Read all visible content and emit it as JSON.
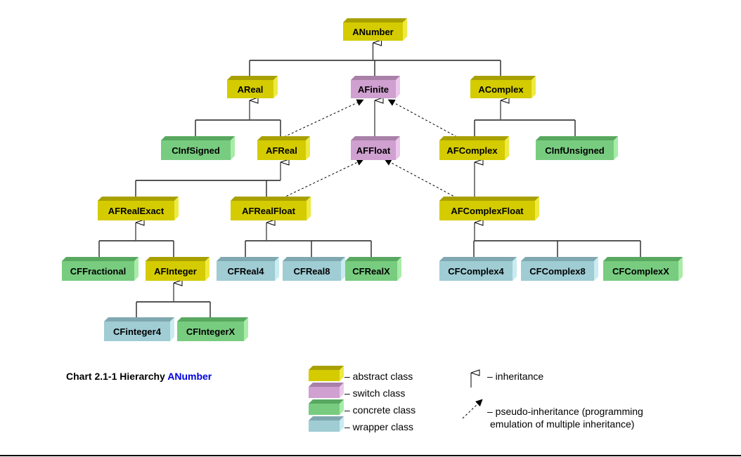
{
  "caption": {
    "prefix": "Chart 2.1-1 Hierarchy ",
    "accent": "ANumber",
    "accent_color": "#0000dd"
  },
  "class_types": {
    "abstract": {
      "front": "#d4cc00",
      "top": "#a8a000",
      "side": "#eeea40"
    },
    "switch": {
      "front": "#cfa0d0",
      "top": "#a880a8",
      "side": "#ecc8ec"
    },
    "concrete": {
      "front": "#78cc80",
      "top": "#58a860",
      "side": "#a8eca8"
    },
    "wrapper": {
      "front": "#a0ccd4",
      "top": "#80a8b0",
      "side": "#c8ecf0"
    }
  },
  "nodes": [
    {
      "id": "ANumber",
      "label": "ANumber",
      "type": "abstract"
    },
    {
      "id": "AReal",
      "label": "AReal",
      "type": "abstract"
    },
    {
      "id": "AFinite",
      "label": "AFinite",
      "type": "switch"
    },
    {
      "id": "AComplex",
      "label": "AComplex",
      "type": "abstract"
    },
    {
      "id": "CInfSigned",
      "label": "CInfSigned",
      "type": "concrete"
    },
    {
      "id": "AFReal",
      "label": "AFReal",
      "type": "abstract"
    },
    {
      "id": "AFFloat",
      "label": "AFFloat",
      "type": "switch"
    },
    {
      "id": "AFComplex",
      "label": "AFComplex",
      "type": "abstract"
    },
    {
      "id": "CInfUnsigned",
      "label": "CInfUnsigned",
      "type": "concrete"
    },
    {
      "id": "AFRealExact",
      "label": "AFRealExact",
      "type": "abstract"
    },
    {
      "id": "AFRealFloat",
      "label": "AFRealFloat",
      "type": "abstract"
    },
    {
      "id": "AFComplexFloat",
      "label": "AFComplexFloat",
      "type": "abstract"
    },
    {
      "id": "CFFractional",
      "label": "CFFractional",
      "type": "concrete"
    },
    {
      "id": "AFInteger",
      "label": "AFInteger",
      "type": "abstract"
    },
    {
      "id": "CFReal4",
      "label": "CFReal4",
      "type": "wrapper"
    },
    {
      "id": "CFReal8",
      "label": "CFReal8",
      "type": "wrapper"
    },
    {
      "id": "CFRealX",
      "label": "CFRealX",
      "type": "concrete"
    },
    {
      "id": "CFComplex4",
      "label": "CFComplex4",
      "type": "wrapper"
    },
    {
      "id": "CFComplex8",
      "label": "CFComplex8",
      "type": "wrapper"
    },
    {
      "id": "CFComplexX",
      "label": "CFComplexX",
      "type": "concrete"
    },
    {
      "id": "CFinteger4",
      "label": "CFinteger4",
      "type": "wrapper"
    },
    {
      "id": "CFIntegerX",
      "label": "CFIntegerX",
      "type": "concrete"
    }
  ],
  "inheritance": [
    {
      "parent": "ANumber",
      "children": [
        "AReal",
        "AFinite",
        "AComplex"
      ]
    },
    {
      "parent": "AReal",
      "children": [
        "CInfSigned",
        "AFReal"
      ]
    },
    {
      "parent": "AFinite",
      "children": [
        "AFFloat"
      ]
    },
    {
      "parent": "AComplex",
      "children": [
        "AFComplex",
        "CInfUnsigned"
      ]
    },
    {
      "parent": "AFReal",
      "children": [
        "AFRealExact",
        "AFRealFloat"
      ]
    },
    {
      "parent": "AFComplex",
      "children": [
        "AFComplexFloat"
      ]
    },
    {
      "parent": "AFRealExact",
      "children": [
        "CFFractional",
        "AFInteger"
      ]
    },
    {
      "parent": "AFRealFloat",
      "children": [
        "CFReal4",
        "CFReal8",
        "CFRealX"
      ]
    },
    {
      "parent": "AFComplexFloat",
      "children": [
        "CFComplex4",
        "CFComplex8",
        "CFComplexX"
      ]
    },
    {
      "parent": "AFInteger",
      "children": [
        "CFinteger4",
        "CFIntegerX"
      ]
    }
  ],
  "pseudo_inheritance": [
    {
      "from": "AFReal",
      "to": "AFinite"
    },
    {
      "from": "AFComplex",
      "to": "AFinite"
    },
    {
      "from": "AFRealFloat",
      "to": "AFFloat"
    },
    {
      "from": "AFComplexFloat",
      "to": "AFFloat"
    }
  ],
  "legend": {
    "classes": [
      {
        "type": "abstract",
        "label": "– abstract class"
      },
      {
        "type": "switch",
        "label": "– switch class"
      },
      {
        "type": "concrete",
        "label": "– concrete class"
      },
      {
        "type": "wrapper",
        "label": "– wrapper class"
      }
    ],
    "arrows": {
      "inheritance": "– inheritance",
      "pseudo_line1": "– pseudo-inheritance (programming",
      "pseudo_line2": "emulation of multiple inheritance)"
    }
  }
}
